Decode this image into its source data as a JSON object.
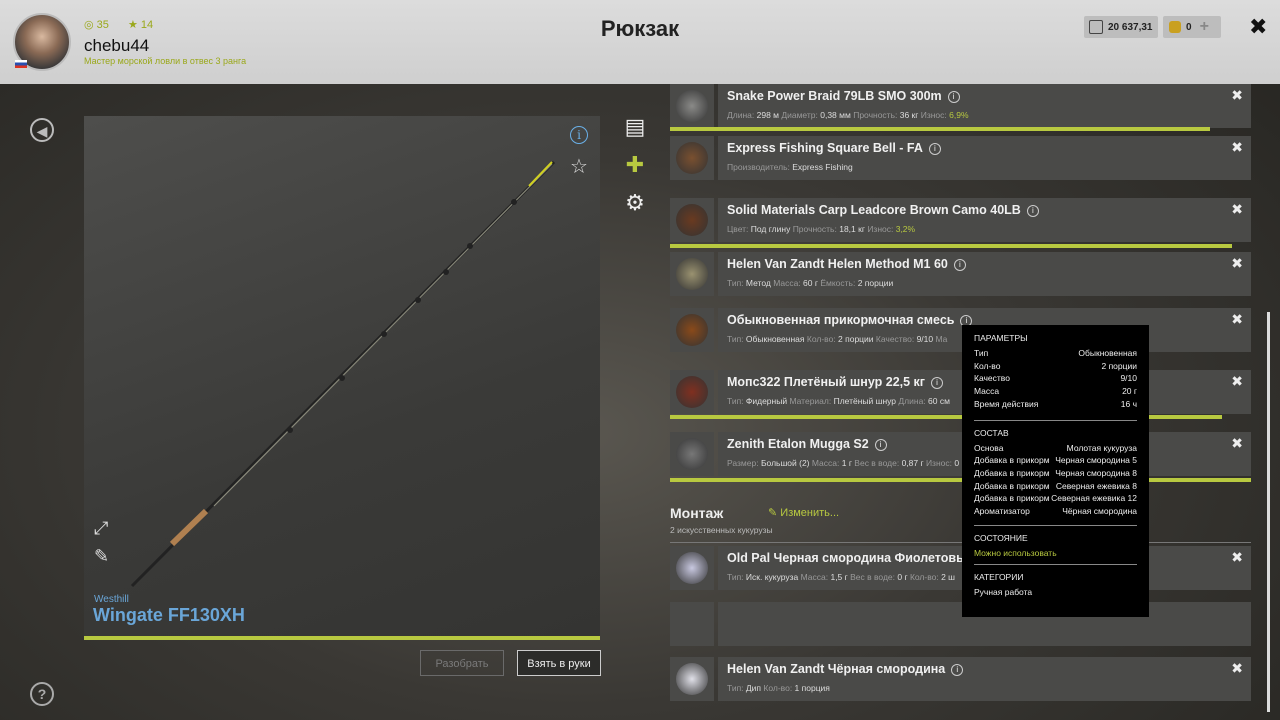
{
  "header": {
    "title": "Рюкзак",
    "user": {
      "name": "chebu44",
      "level": "35",
      "rank_stars": "14",
      "rank_title": "Мастер морской ловли в отвес 3 ранга"
    },
    "currency": {
      "silver": "20 637,31",
      "gold": "0",
      "add_label": "+"
    },
    "close_label": "✖"
  },
  "rod": {
    "brand": "Westhill",
    "model": "Wingate FF130XH",
    "condition": 1.0,
    "buttons": {
      "disassemble": "Разобрать",
      "take": "Взять в руки"
    }
  },
  "tabs": [
    "notes-icon",
    "puzzle-icon",
    "gear-icon"
  ],
  "items": [
    {
      "name": "Snake Power Braid 79LB SMO 300m",
      "props": [
        [
          "Длина:",
          "298 м"
        ],
        [
          "Диаметр:",
          "0,38 мм"
        ],
        [
          "Прочность:",
          "36 кг"
        ],
        [
          "Износ:",
          "6,9%"
        ]
      ],
      "wear": 0.93
    },
    {
      "name": "Express Fishing Square Bell - FA",
      "props": [
        [
          "Производитель:",
          "Express Fishing"
        ]
      ]
    },
    {
      "name": "Solid Materials Carp Leadcore Brown Camo 40LB",
      "props": [
        [
          "Цвет:",
          "Под глину"
        ],
        [
          "Прочность:",
          "18,1 кг"
        ],
        [
          "Износ:",
          "3,2%"
        ]
      ],
      "wear": 0.968
    },
    {
      "name": "Helen Van Zandt Helen Method M1 60",
      "props": [
        [
          "Тип:",
          "Метод"
        ],
        [
          "Масса:",
          "60 г"
        ],
        [
          "Ёмкость:",
          "2 порции"
        ]
      ]
    },
    {
      "name": "Обыкновенная прикормочная смесь",
      "props": [
        [
          "Тип:",
          "Обыкновенная"
        ],
        [
          "Кол-во:",
          "2 порции"
        ],
        [
          "Качество:",
          "9/10"
        ],
        [
          "Ма",
          ""
        ]
      ]
    },
    {
      "name": "Мопс322 Плетёный шнур 22,5 кг",
      "props": [
        [
          "Тип:",
          "Фидерный"
        ],
        [
          "Материал:",
          "Плетёный шнур"
        ],
        [
          "Длина:",
          "60 см"
        ]
      ],
      "wear": 0.95
    },
    {
      "name": "Zenith Etalon Mugga S2",
      "props": [
        [
          "Размер:",
          "Большой (2)"
        ],
        [
          "Масса:",
          "1 г"
        ],
        [
          "Вес в воде:",
          "0,87 г"
        ],
        [
          "Износ:",
          "0"
        ]
      ],
      "wear": 1.0
    }
  ],
  "montage": {
    "title": "Монтаж",
    "edit_label": "Изменить...",
    "subtitle": "2 искусственных кукурузы",
    "items": [
      {
        "name": "Old Pal Черная смородина Фиолетовый",
        "props": [
          [
            "Тип:",
            "Иск. кукуруза"
          ],
          [
            "Масса:",
            "1,5 г"
          ],
          [
            "Вес в воде:",
            "0 г"
          ],
          [
            "Кол-во:",
            "2 ш"
          ]
        ]
      },
      {
        "name": "Helen Van Zandt Чёрная смородина",
        "props": [
          [
            "Тип:",
            "Дип"
          ],
          [
            "Кол-во:",
            "1 порция"
          ]
        ]
      }
    ]
  },
  "tooltip": {
    "params_title": "ПАРАМЕТРЫ",
    "params": [
      [
        "Тип",
        "Обыкновенная"
      ],
      [
        "Кол-во",
        "2 порции"
      ],
      [
        "Качество",
        "9/10"
      ],
      [
        "Масса",
        "20 г"
      ],
      [
        "Время действия",
        "16 ч"
      ]
    ],
    "composition_title": "СОСТАВ",
    "composition": [
      [
        "Основа",
        "Молотая кукуруза"
      ],
      [
        "Добавка в прикорм",
        "Черная смородина 5"
      ],
      [
        "Добавка в прикорм",
        "Черная смородина 8"
      ],
      [
        "Добавка в прикорм",
        "Северная ежевика 8"
      ],
      [
        "Добавка в прикорм",
        "Северная ежевика 12"
      ],
      [
        "Ароматизатор",
        "Чёрная смородина"
      ]
    ],
    "state_title": "СОСТОЯНИЕ",
    "state": "Можно использовать",
    "categories_title": "КАТЕГОРИИ",
    "category": "Ручная работа"
  },
  "colors": {
    "accent": "#b8c940",
    "link": "#6aa6d8"
  }
}
